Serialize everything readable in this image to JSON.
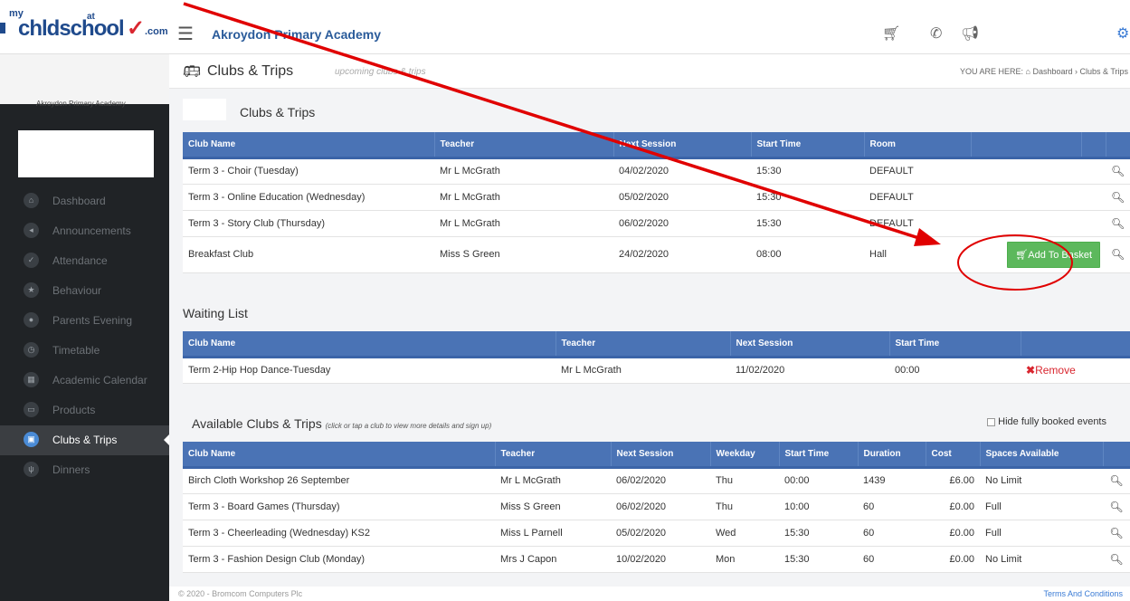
{
  "header": {
    "logo": {
      "my": "my",
      "word": "chldschool",
      "at": "at",
      "com": ".com"
    },
    "school_name": "Akroydon Primary Academy"
  },
  "sidebar": {
    "school_logo_text": "Akroydon Primary Academy",
    "items": [
      {
        "label": "Dashboard",
        "icon": "home-icon",
        "glyph": "⌂"
      },
      {
        "label": "Announcements",
        "icon": "megaphone-icon",
        "glyph": "◂"
      },
      {
        "label": "Attendance",
        "icon": "check-icon",
        "glyph": "✓"
      },
      {
        "label": "Behaviour",
        "icon": "star-icon",
        "glyph": "★"
      },
      {
        "label": "Parents Evening",
        "icon": "people-icon",
        "glyph": "●"
      },
      {
        "label": "Timetable",
        "icon": "clock-icon",
        "glyph": "◷"
      },
      {
        "label": "Academic Calendar",
        "icon": "calendar-icon",
        "glyph": "▦"
      },
      {
        "label": "Products",
        "icon": "card-icon",
        "glyph": "▭"
      },
      {
        "label": "Clubs & Trips",
        "icon": "bus-icon",
        "glyph": "▣",
        "active": true
      },
      {
        "label": "Dinners",
        "icon": "cutlery-icon",
        "glyph": "ψ"
      }
    ]
  },
  "page": {
    "title": "Clubs & Trips",
    "subtitle": "upcoming clubs & trips",
    "breadcrumb": "YOU ARE HERE:  ⌂ Dashboard  ›  Clubs & Trips"
  },
  "clubs": {
    "title": "Clubs & Trips",
    "headers": [
      "Club Name",
      "Teacher",
      "Next Session",
      "Start Time",
      "Room"
    ],
    "rows": [
      {
        "name": "Term 3 - Choir (Tuesday)",
        "teacher": "Mr L McGrath",
        "next": "04/02/2020",
        "start": "15:30",
        "room": "DEFAULT"
      },
      {
        "name": "Term 3 - Online Education (Wednesday)",
        "teacher": "Mr L McGrath",
        "next": "05/02/2020",
        "start": "15:30",
        "room": "DEFAULT"
      },
      {
        "name": "Term 3 - Story Club (Thursday)",
        "teacher": "Mr L McGrath",
        "next": "06/02/2020",
        "start": "15:30",
        "room": "DEFAULT"
      },
      {
        "name": "Breakfast Club",
        "teacher": "Miss S Green",
        "next": "24/02/2020",
        "start": "08:00",
        "room": "Hall",
        "action": "Add To Basket"
      }
    ]
  },
  "waiting": {
    "title": "Waiting List",
    "headers": [
      "Club Name",
      "Teacher",
      "Next Session",
      "Start Time"
    ],
    "rows": [
      {
        "name": "Term 2-Hip Hop Dance-Tuesday",
        "teacher": "Mr L McGrath",
        "next": "11/02/2020",
        "start": "00:00",
        "action": "Remove"
      }
    ]
  },
  "available": {
    "title": "Available Clubs & Trips",
    "hint": "(click or tap a club to view more details and sign up)",
    "hide_booked_label": "Hide fully booked events",
    "headers": [
      "Club Name",
      "Teacher",
      "Next Session",
      "Weekday",
      "Start Time",
      "Duration",
      "Cost",
      "Spaces Available"
    ],
    "rows": [
      {
        "name": "Birch Cloth Workshop 26 September",
        "teacher": "Mr L McGrath",
        "next": "06/02/2020",
        "weekday": "Thu",
        "start": "00:00",
        "duration": "1439",
        "cost": "£6.00",
        "spaces": "No Limit"
      },
      {
        "name": "Term 3 - Board Games (Thursday)",
        "teacher": "Miss S Green",
        "next": "06/02/2020",
        "weekday": "Thu",
        "start": "10:00",
        "duration": "60",
        "cost": "£0.00",
        "spaces": "Full"
      },
      {
        "name": "Term 3 - Cheerleading (Wednesday) KS2",
        "teacher": "Miss L Parnell",
        "next": "05/02/2020",
        "weekday": "Wed",
        "start": "15:30",
        "duration": "60",
        "cost": "£0.00",
        "spaces": "Full"
      },
      {
        "name": "Term 3 - Fashion Design Club (Monday)",
        "teacher": "Mrs J Capon",
        "next": "10/02/2020",
        "weekday": "Mon",
        "start": "15:30",
        "duration": "60",
        "cost": "£0.00",
        "spaces": "No Limit"
      }
    ]
  },
  "footer": {
    "copyright": "© 2020 - Bromcom Computers Plc",
    "terms": "Terms And Conditions"
  },
  "colors": {
    "header_blue": "#4a73b5",
    "sidebar_bg": "#202326",
    "add_green": "#5cb85c",
    "annotation_red": "#e00000"
  }
}
